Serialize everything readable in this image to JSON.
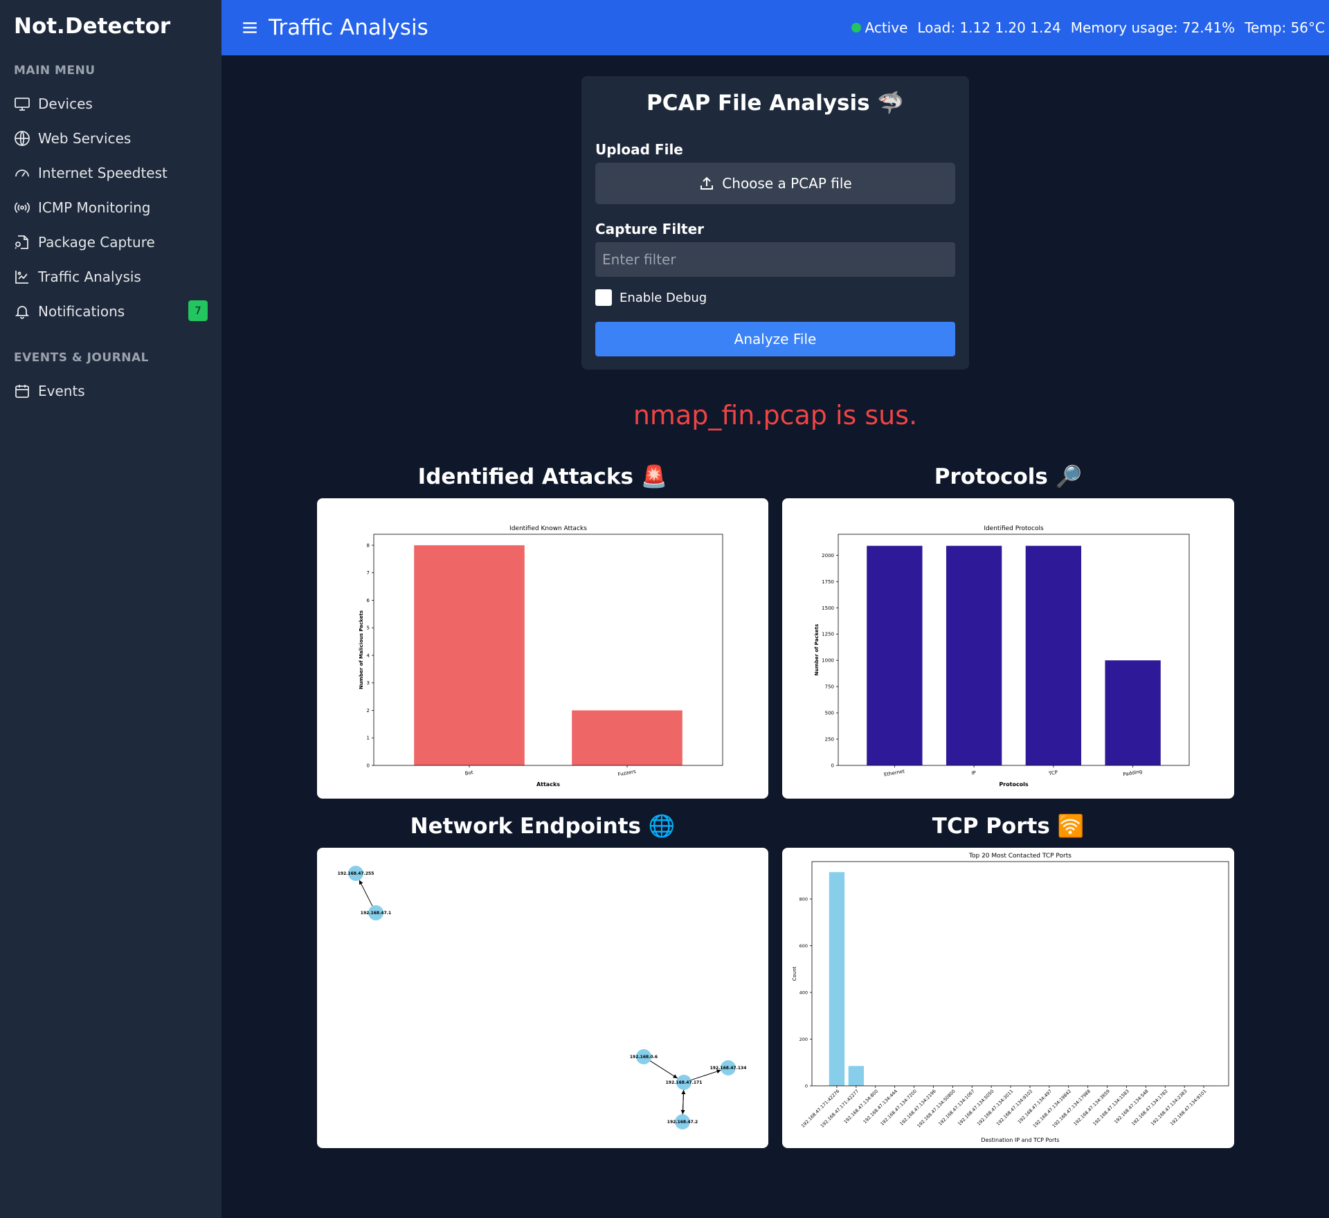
{
  "sidebar": {
    "brand": "Not.Detector",
    "main_menu_label": "MAIN MENU",
    "items": [
      {
        "label": "Devices",
        "icon": "monitor-icon"
      },
      {
        "label": "Web Services",
        "icon": "globe-icon"
      },
      {
        "label": "Internet Speedtest",
        "icon": "gauge-icon"
      },
      {
        "label": "ICMP Monitoring",
        "icon": "broadcast-icon"
      },
      {
        "label": "Package Capture",
        "icon": "file-search-icon"
      },
      {
        "label": "Traffic Analysis",
        "icon": "chart-icon"
      },
      {
        "label": "Notifications",
        "icon": "bell-icon",
        "badge": "7"
      }
    ],
    "events_label": "EVENTS & JOURNAL",
    "events_item": {
      "label": "Events",
      "icon": "calendar-icon"
    }
  },
  "header": {
    "title": "Traffic Analysis",
    "status": "Active",
    "load": "Load: 1.12 1.20 1.24",
    "memory": "Memory usage: 72.41%",
    "temp": "Temp: 56°C"
  },
  "upload_card": {
    "title": "PCAP File Analysis 🦈",
    "upload_label": "Upload File",
    "file_button": "Choose a PCAP file",
    "filter_label": "Capture Filter",
    "filter_placeholder": "Enter filter",
    "filter_value": "",
    "debug_label": "Enable Debug",
    "debug_checked": false,
    "analyze_button": "Analyze File"
  },
  "result_text": "nmap_fin.pcap is sus.",
  "sections": {
    "attacks": "Identified Attacks 🚨",
    "protocols": "Protocols 🔎",
    "endpoints": "Network Endpoints 🌐",
    "ports": "TCP Ports 🛜"
  },
  "colors": {
    "attack_bar": "#ee6666",
    "protocol_bar": "#2e1a98",
    "port_bar": "#87ceeb",
    "node": "#87ceeb",
    "accent": "#2563eb",
    "result": "#ef4444"
  },
  "chart_data": [
    {
      "type": "bar",
      "title": "Identified Known Attacks",
      "xlabel": "Attacks",
      "ylabel": "Number of Malicious Packets",
      "categories": [
        "Bot",
        "Fuzzers"
      ],
      "values": [
        8,
        2
      ],
      "ylim": [
        0,
        8.4
      ],
      "yticks": [
        0,
        1,
        2,
        3,
        4,
        5,
        6,
        7,
        8
      ]
    },
    {
      "type": "bar",
      "title": "Identified Protocols",
      "xlabel": "Protocols",
      "ylabel": "Number of Packets",
      "categories": [
        "Ethernet",
        "IP",
        "TCP",
        "Padding"
      ],
      "values": [
        2090,
        2090,
        2090,
        1000
      ],
      "ylim": [
        0,
        2200
      ],
      "yticks": [
        0,
        250,
        500,
        750,
        1000,
        1250,
        1500,
        1750,
        2000
      ]
    },
    {
      "type": "bar",
      "title": "Top 20 Most Contacted TCP Ports",
      "xlabel": "Destination IP and TCP Ports",
      "ylabel": "Count",
      "categories": [
        "192.168.47.171:42276",
        "192.168.47.171:42277",
        "192.168.47.134:800",
        "192.168.47.134:444",
        "192.168.47.134:7200",
        "192.168.47.134:2196",
        "192.168.47.134:50800",
        "192.168.47.134:1067",
        "192.168.47.134:5050",
        "192.168.47.134:3011",
        "192.168.47.134:9102",
        "192.168.47.134:497",
        "192.168.47.134:19842",
        "192.168.47.134:17988",
        "192.168.47.134:3659",
        "192.168.47.134:1583",
        "192.168.47.134:548",
        "192.168.47.134:1782",
        "192.168.47.134:2383",
        "192.168.47.134:9101"
      ],
      "values": [
        915,
        85,
        1,
        1,
        1,
        1,
        1,
        1,
        1,
        1,
        1,
        1,
        1,
        1,
        1,
        1,
        1,
        1,
        1,
        1
      ],
      "ylim": [
        0,
        960
      ],
      "yticks": [
        0,
        200,
        400,
        600,
        800
      ]
    }
  ],
  "network_graph": {
    "nodes": [
      "192.168.47.255",
      "192.168.47.1",
      "192.168.0.6",
      "192.168.47.171",
      "192.168.47.134",
      "192.168.47.2"
    ],
    "edges": [
      [
        "192.168.47.1",
        "192.168.47.255"
      ],
      [
        "192.168.0.6",
        "192.168.47.171"
      ],
      [
        "192.168.47.171",
        "192.168.47.134"
      ],
      [
        "192.168.47.2",
        "192.168.47.171"
      ],
      [
        "192.168.47.171",
        "192.168.47.2"
      ]
    ]
  }
}
